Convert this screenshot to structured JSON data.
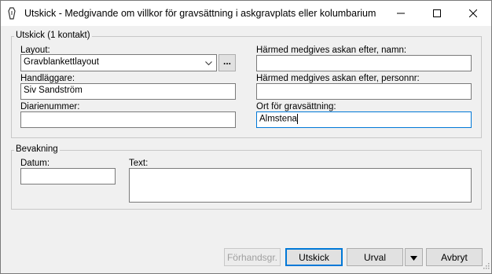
{
  "window": {
    "title": "Utskick - Medgivande om villkor för gravsättning i askgravplats eller kolumbarium",
    "minimize_glyph": "—",
    "maximize_glyph": "☐",
    "close_glyph": "✕"
  },
  "utskick_group": {
    "label": "Utskick (1 kontakt)",
    "layout_label": "Layout:",
    "layout_value": "Gravblankettlayout",
    "layout_browse": "...",
    "handlaggare_label": "Handläggare:",
    "handlaggare_value": "Siv Sandström",
    "diarienummer_label": "Diarienummer:",
    "diarienummer_value": "",
    "namn_label": "Härmed medgives askan efter, namn:",
    "namn_value": "",
    "personnr_label": "Härmed medgives askan efter, personnr:",
    "personnr_value": "",
    "ort_label": "Ort för gravsättning:",
    "ort_value": "Almstena"
  },
  "bevakning_group": {
    "label": "Bevakning",
    "datum_label": "Datum:",
    "datum_value": "",
    "text_label": "Text:",
    "text_value": ""
  },
  "buttons": {
    "forhandsgr": "Förhandsgr.",
    "utskick": "Utskick",
    "urval": "Urval",
    "avbryt": "Avbryt"
  },
  "icons": {
    "app": "coffin-icon",
    "dropdown": "chevron-down-icon",
    "split": "triangle-down-icon"
  }
}
